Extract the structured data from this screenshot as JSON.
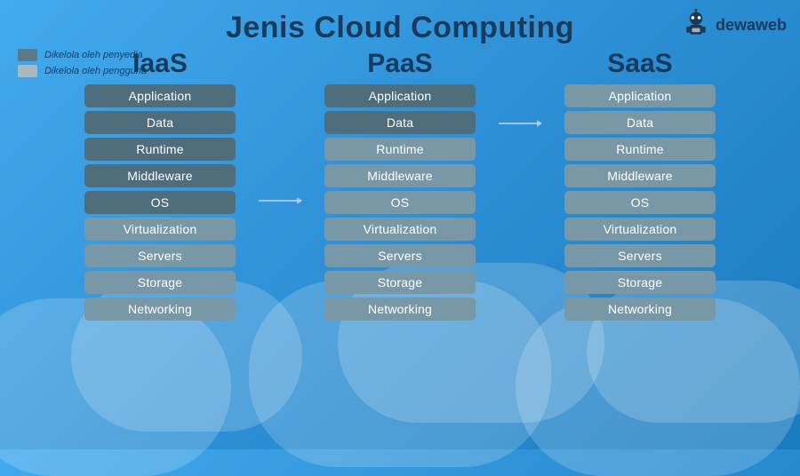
{
  "title": "Jenis Cloud Computing",
  "logo": {
    "text": "dewaweb",
    "icon": "robot-icon"
  },
  "legend": {
    "items": [
      {
        "type": "dark",
        "label": "Dikelola oleh penyedia"
      },
      {
        "type": "light",
        "label": "Dikelola oleh pengguna"
      }
    ]
  },
  "columns": [
    {
      "id": "iaas",
      "title": "IaaS",
      "stack": [
        {
          "label": "Application",
          "style": "user"
        },
        {
          "label": "Data",
          "style": "user"
        },
        {
          "label": "Runtime",
          "style": "user"
        },
        {
          "label": "Middleware",
          "style": "user"
        },
        {
          "label": "OS",
          "style": "user"
        },
        {
          "label": "Virtualization",
          "style": "provider"
        },
        {
          "label": "Servers",
          "style": "provider"
        },
        {
          "label": "Storage",
          "style": "provider"
        },
        {
          "label": "Networking",
          "style": "provider"
        }
      ]
    },
    {
      "id": "paas",
      "title": "PaaS",
      "stack": [
        {
          "label": "Application",
          "style": "user"
        },
        {
          "label": "Data",
          "style": "user"
        },
        {
          "label": "Runtime",
          "style": "provider"
        },
        {
          "label": "Middleware",
          "style": "provider"
        },
        {
          "label": "OS",
          "style": "provider"
        },
        {
          "label": "Virtualization",
          "style": "provider"
        },
        {
          "label": "Servers",
          "style": "provider"
        },
        {
          "label": "Storage",
          "style": "provider"
        },
        {
          "label": "Networking",
          "style": "provider"
        }
      ]
    },
    {
      "id": "saas",
      "title": "SaaS",
      "stack": [
        {
          "label": "Application",
          "style": "provider"
        },
        {
          "label": "Data",
          "style": "provider"
        },
        {
          "label": "Runtime",
          "style": "provider"
        },
        {
          "label": "Middleware",
          "style": "provider"
        },
        {
          "label": "OS",
          "style": "provider"
        },
        {
          "label": "Virtualization",
          "style": "provider"
        },
        {
          "label": "Servers",
          "style": "provider"
        },
        {
          "label": "Storage",
          "style": "provider"
        },
        {
          "label": "Networking",
          "style": "provider"
        }
      ]
    }
  ]
}
